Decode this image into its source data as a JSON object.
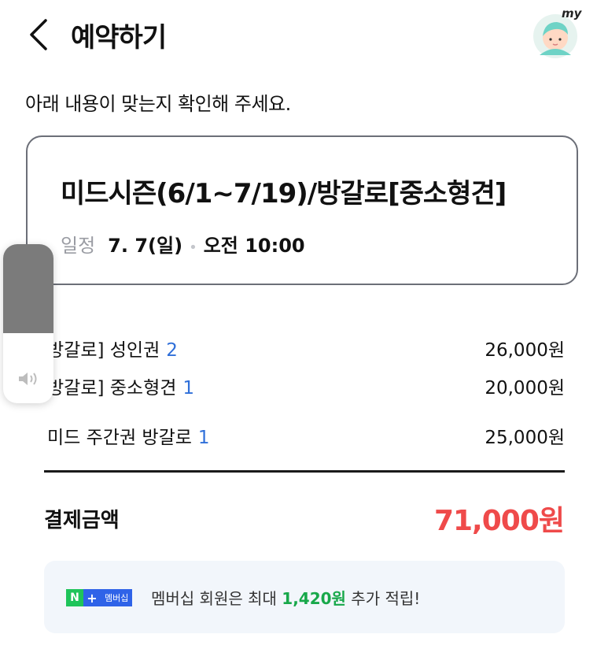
{
  "header": {
    "title": "예약하기",
    "my_label": "my"
  },
  "instruction": "아래 내용이 맞는지 확인해 주세요.",
  "booking": {
    "product_title": "미드시즌(6/1~7/19)/방갈로[중소형견]",
    "schedule_label": "일정",
    "date": "7. 7(일)",
    "time": "오전 10:00"
  },
  "line_items": [
    {
      "name": "방갈로] 성인권",
      "qty": "2",
      "price": "26,000원"
    },
    {
      "name": "방갈로] 중소형견",
      "qty": "1",
      "price": "20,000원"
    },
    {
      "name": "미드 주간권 방갈로",
      "qty": "1",
      "price": "25,000원"
    }
  ],
  "total": {
    "label": "결제금액",
    "amount": "71,000원"
  },
  "membership": {
    "badge_n": "N",
    "badge_plus": "+",
    "badge_label": "멤버십",
    "text_before": "멤버십 회원은 최대 ",
    "amount": "1,420원",
    "text_after": " 추가 적립!"
  },
  "volume_overlay": {
    "level": 0.56,
    "icon": "speaker-icon"
  },
  "colors": {
    "total_red": "#ef4a4a",
    "qty_blue": "#2f6fd9",
    "naver_green": "#1fc45a",
    "membership_blue": "#2f63e8"
  }
}
